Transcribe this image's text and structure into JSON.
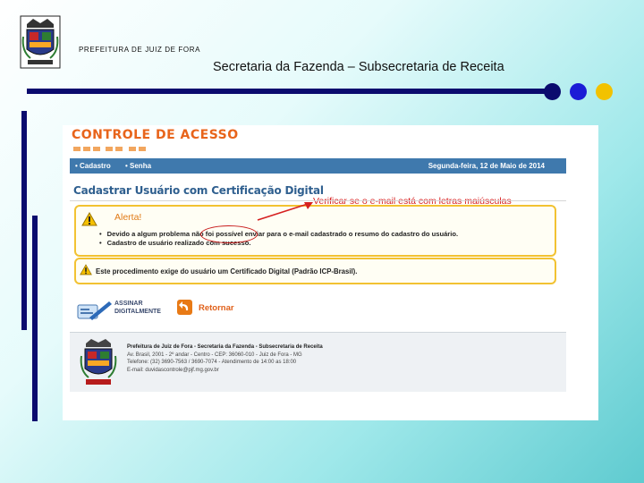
{
  "slide": {
    "prefeitura_label": "PREFEITURA DE JUIZ DE FORA",
    "title": "Secretaria da Fazenda – Subsecretaria de Receita",
    "accent_colors": [
      "#0b0b6e",
      "#1c1cd6",
      "#f2c200"
    ]
  },
  "screenshot": {
    "header_title": "CONTROLE DE ACESSO",
    "nav": {
      "items": [
        "• Cadastro",
        "• Senha"
      ],
      "date": "Segunda-feira, 12 de Maio de 2014"
    },
    "page_heading": "Cadastrar Usuário com Certificação Digital",
    "annotation": "Verificar se o e-mail está com letras maiúsculas",
    "alert": {
      "title": "Alerta!",
      "icon": "warning-icon",
      "messages": [
        "Devido a algum problema não foi possível enviar para o e-mail cadastrado o resumo do cadastro do usuário.",
        "Cadastro de usuário realizado com sucesso."
      ]
    },
    "notice": "Este procedimento exige do usuário um Certificado Digital (Padrão ICP-Brasil).",
    "buttons": {
      "sign_line1": "ASSINAR",
      "sign_line2": "DIGITALMENTE",
      "return": "Retornar"
    },
    "footer": {
      "line1": "Prefeitura de Juiz de Fora - Secretaria da Fazenda - Subsecretaria de Receita",
      "line2": "Av. Brasil, 2001 - 2º andar - Centro - CEP: 36060-010 - Juiz de Fora - MG",
      "line3": "Telefone: (32) 3690-7563 / 3690-7074 - Atendimento de 14:00 as 18:00",
      "line4": "E-mail: duvidascontrole@pjf.mg.gov.br"
    }
  }
}
